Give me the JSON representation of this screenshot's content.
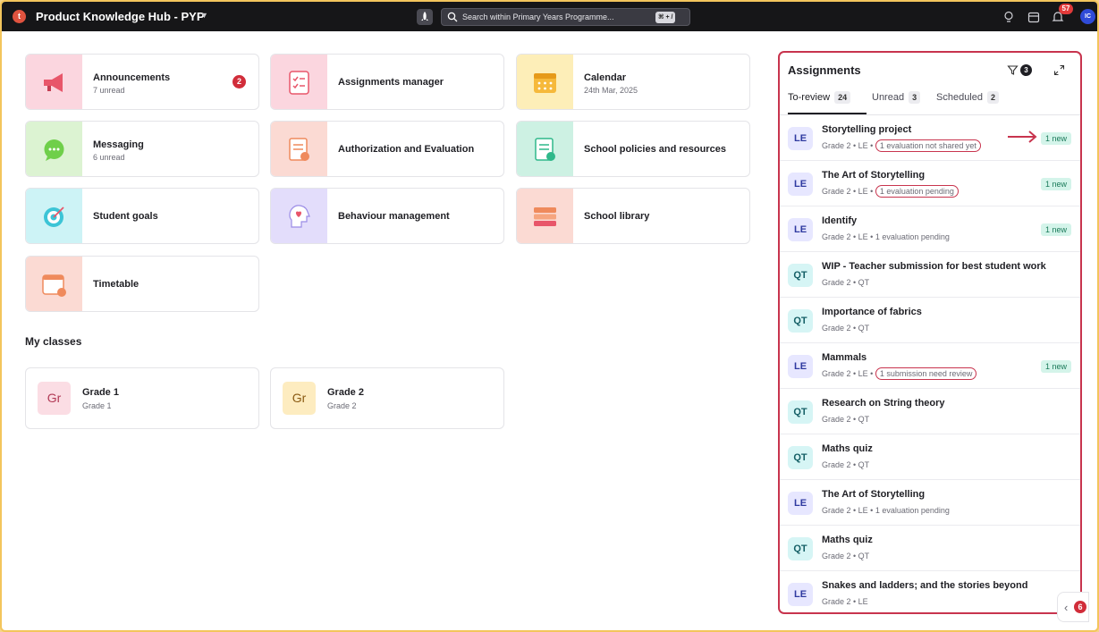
{
  "app": {
    "logo_letter": "t",
    "title": "Product Knowledge Hub - PYP"
  },
  "search": {
    "placeholder": "Search within Primary Years Programme...",
    "shortcut": "⌘ + /"
  },
  "header": {
    "notifications_count": "57",
    "avatar_initials": "IC"
  },
  "tiles": [
    {
      "name": "Announcements",
      "sub": "7 unread",
      "badge": "2",
      "color": "#fbd6df",
      "icon": "megaphone-icon"
    },
    {
      "name": "Assignments manager",
      "sub": "",
      "color": "#fbd6df",
      "icon": "checklist-icon"
    },
    {
      "name": "Calendar",
      "sub": "24th Mar, 2025",
      "color": "#fdeeb8",
      "icon": "calendar-icon"
    },
    {
      "name": "Messaging",
      "sub": "6 unread",
      "color": "#dcf3d2",
      "icon": "chat-icon"
    },
    {
      "name": "Authorization and Evaluation",
      "sub": "",
      "color": "#fbdad3",
      "icon": "certificate-icon"
    },
    {
      "name": "School policies and resources",
      "sub": "",
      "color": "#cdf1e3",
      "icon": "policy-document-icon"
    },
    {
      "name": "Student goals",
      "sub": "",
      "color": "#cdf3f6",
      "icon": "target-icon"
    },
    {
      "name": "Behaviour management",
      "sub": "",
      "color": "#e3ddfb",
      "icon": "heart-head-icon"
    },
    {
      "name": "School library",
      "sub": "",
      "color": "#fbdad3",
      "icon": "books-icon"
    },
    {
      "name": "Timetable",
      "sub": "",
      "color": "#fbdad3",
      "icon": "timetable-icon"
    }
  ],
  "my_classes": {
    "title": "My classes",
    "classes": [
      {
        "avatar": "Gr",
        "name": "Grade 1",
        "sub": "Grade 1",
        "bg": "#fbdde4",
        "fg": "#b23a56"
      },
      {
        "avatar": "Gr",
        "name": "Grade 2",
        "sub": "Grade 2",
        "bg": "#fdecc0",
        "fg": "#8a5a12"
      }
    ]
  },
  "assignments": {
    "title": "Assignments",
    "filter_count": "3",
    "tabs": [
      {
        "label": "To-review",
        "count": "24",
        "active": true
      },
      {
        "label": "Unread",
        "count": "3",
        "active": false
      },
      {
        "label": "Scheduled",
        "count": "2",
        "active": false
      }
    ],
    "items": [
      {
        "type": "LE",
        "title": "Storytelling project",
        "meta": "Grade 2 • LE • ",
        "status": "1 evaluation not shared yet",
        "highlight": true,
        "new": "1 new",
        "arrow": true
      },
      {
        "type": "LE",
        "title": "The Art of Storytelling",
        "meta": "Grade 2 • LE • ",
        "status": "1 evaluation pending",
        "highlight": true,
        "new": "1 new"
      },
      {
        "type": "LE",
        "title": "Identify",
        "meta": "Grade 2 • LE • ",
        "status": "1 evaluation pending",
        "highlight": false,
        "new": "1 new"
      },
      {
        "type": "QT",
        "title": "WIP - Teacher submission for best student work",
        "meta": "Grade 2 • QT",
        "status": "",
        "highlight": false,
        "new": ""
      },
      {
        "type": "QT",
        "title": "Importance of fabrics",
        "meta": "Grade 2 • QT",
        "status": "",
        "highlight": false,
        "new": ""
      },
      {
        "type": "LE",
        "title": "Mammals",
        "meta": "Grade 2 • LE • ",
        "status": "1 submission need review",
        "highlight": true,
        "new": "1 new"
      },
      {
        "type": "QT",
        "title": "Research on String theory",
        "meta": "Grade 2 • QT",
        "status": "",
        "highlight": false,
        "new": ""
      },
      {
        "type": "QT",
        "title": "Maths quiz",
        "meta": "Grade 2 • QT",
        "status": "",
        "highlight": false,
        "new": ""
      },
      {
        "type": "LE",
        "title": "The Art of Storytelling",
        "meta": "Grade 2 • LE • ",
        "status": "1 evaluation pending",
        "highlight": false,
        "new": ""
      },
      {
        "type": "QT",
        "title": "Maths quiz",
        "meta": "Grade 2 • QT",
        "status": "",
        "highlight": false,
        "new": ""
      },
      {
        "type": "LE",
        "title": "Snakes and ladders; and the stories beyond",
        "meta": "Grade 2 • LE",
        "status": "",
        "highlight": false,
        "new": ""
      }
    ]
  },
  "side_toggle": {
    "count": "6"
  },
  "colors": {
    "accent": "#c8344e",
    "topbar": "#161618",
    "new_badge": "#d4f4ea"
  }
}
